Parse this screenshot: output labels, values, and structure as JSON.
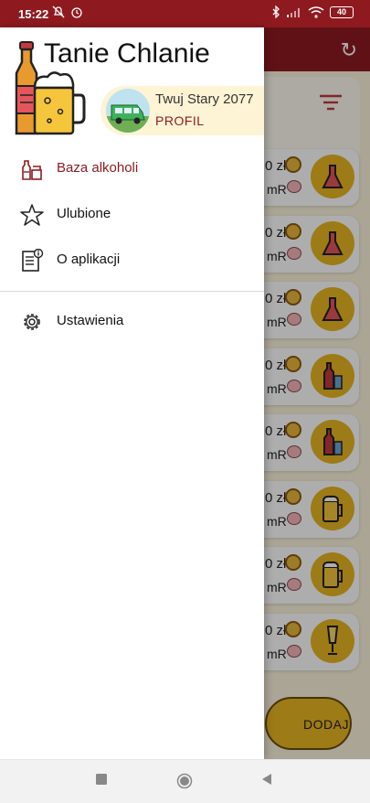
{
  "status_bar": {
    "time": "15:22",
    "battery": "40",
    "icons_left": [
      "mute-bell-icon",
      "alarm-icon"
    ],
    "icons_right": [
      "bluetooth-icon",
      "signal-icon",
      "wifi-icon",
      "battery-icon"
    ]
  },
  "drawer": {
    "app_title": "Tanie Chlanie",
    "profile": {
      "user_name": "Twuj Stary 2077",
      "link_label": "PROFIL"
    },
    "menu": [
      {
        "label": "Baza alkoholi",
        "icon": "bottles-icon",
        "active": true
      },
      {
        "label": "Ulubione",
        "icon": "star-icon",
        "active": false
      },
      {
        "label": "O aplikacji",
        "icon": "info-document-icon",
        "active": false
      }
    ],
    "settings": {
      "label": "Ustawienia",
      "icon": "gear-icon"
    }
  },
  "background": {
    "list_items": [
      {
        "price": "0 zł",
        "unit": "mR",
        "icon": "flask-icon"
      },
      {
        "price": "0 zł",
        "unit": "mR",
        "icon": "flask-icon"
      },
      {
        "price": "0 zł",
        "unit": "mR",
        "icon": "flask-icon"
      },
      {
        "price": "0 zł",
        "unit": "mR",
        "icon": "wine-bottle-icon"
      },
      {
        "price": "0 zł",
        "unit": "mR",
        "icon": "wine-bottle-icon"
      },
      {
        "price": "0 zł",
        "unit": "mR",
        "icon": "beer-mug-icon"
      },
      {
        "price": "0 zł",
        "unit": "mR",
        "icon": "beer-mug-icon"
      },
      {
        "price": "0 zł",
        "unit": "mR",
        "icon": "champagne-glass-icon"
      }
    ],
    "fab_label": "DODAJ"
  },
  "colors": {
    "primary": "#8e1a1f",
    "accent": "#e8b521",
    "profile_bg": "#fdf3d5"
  }
}
